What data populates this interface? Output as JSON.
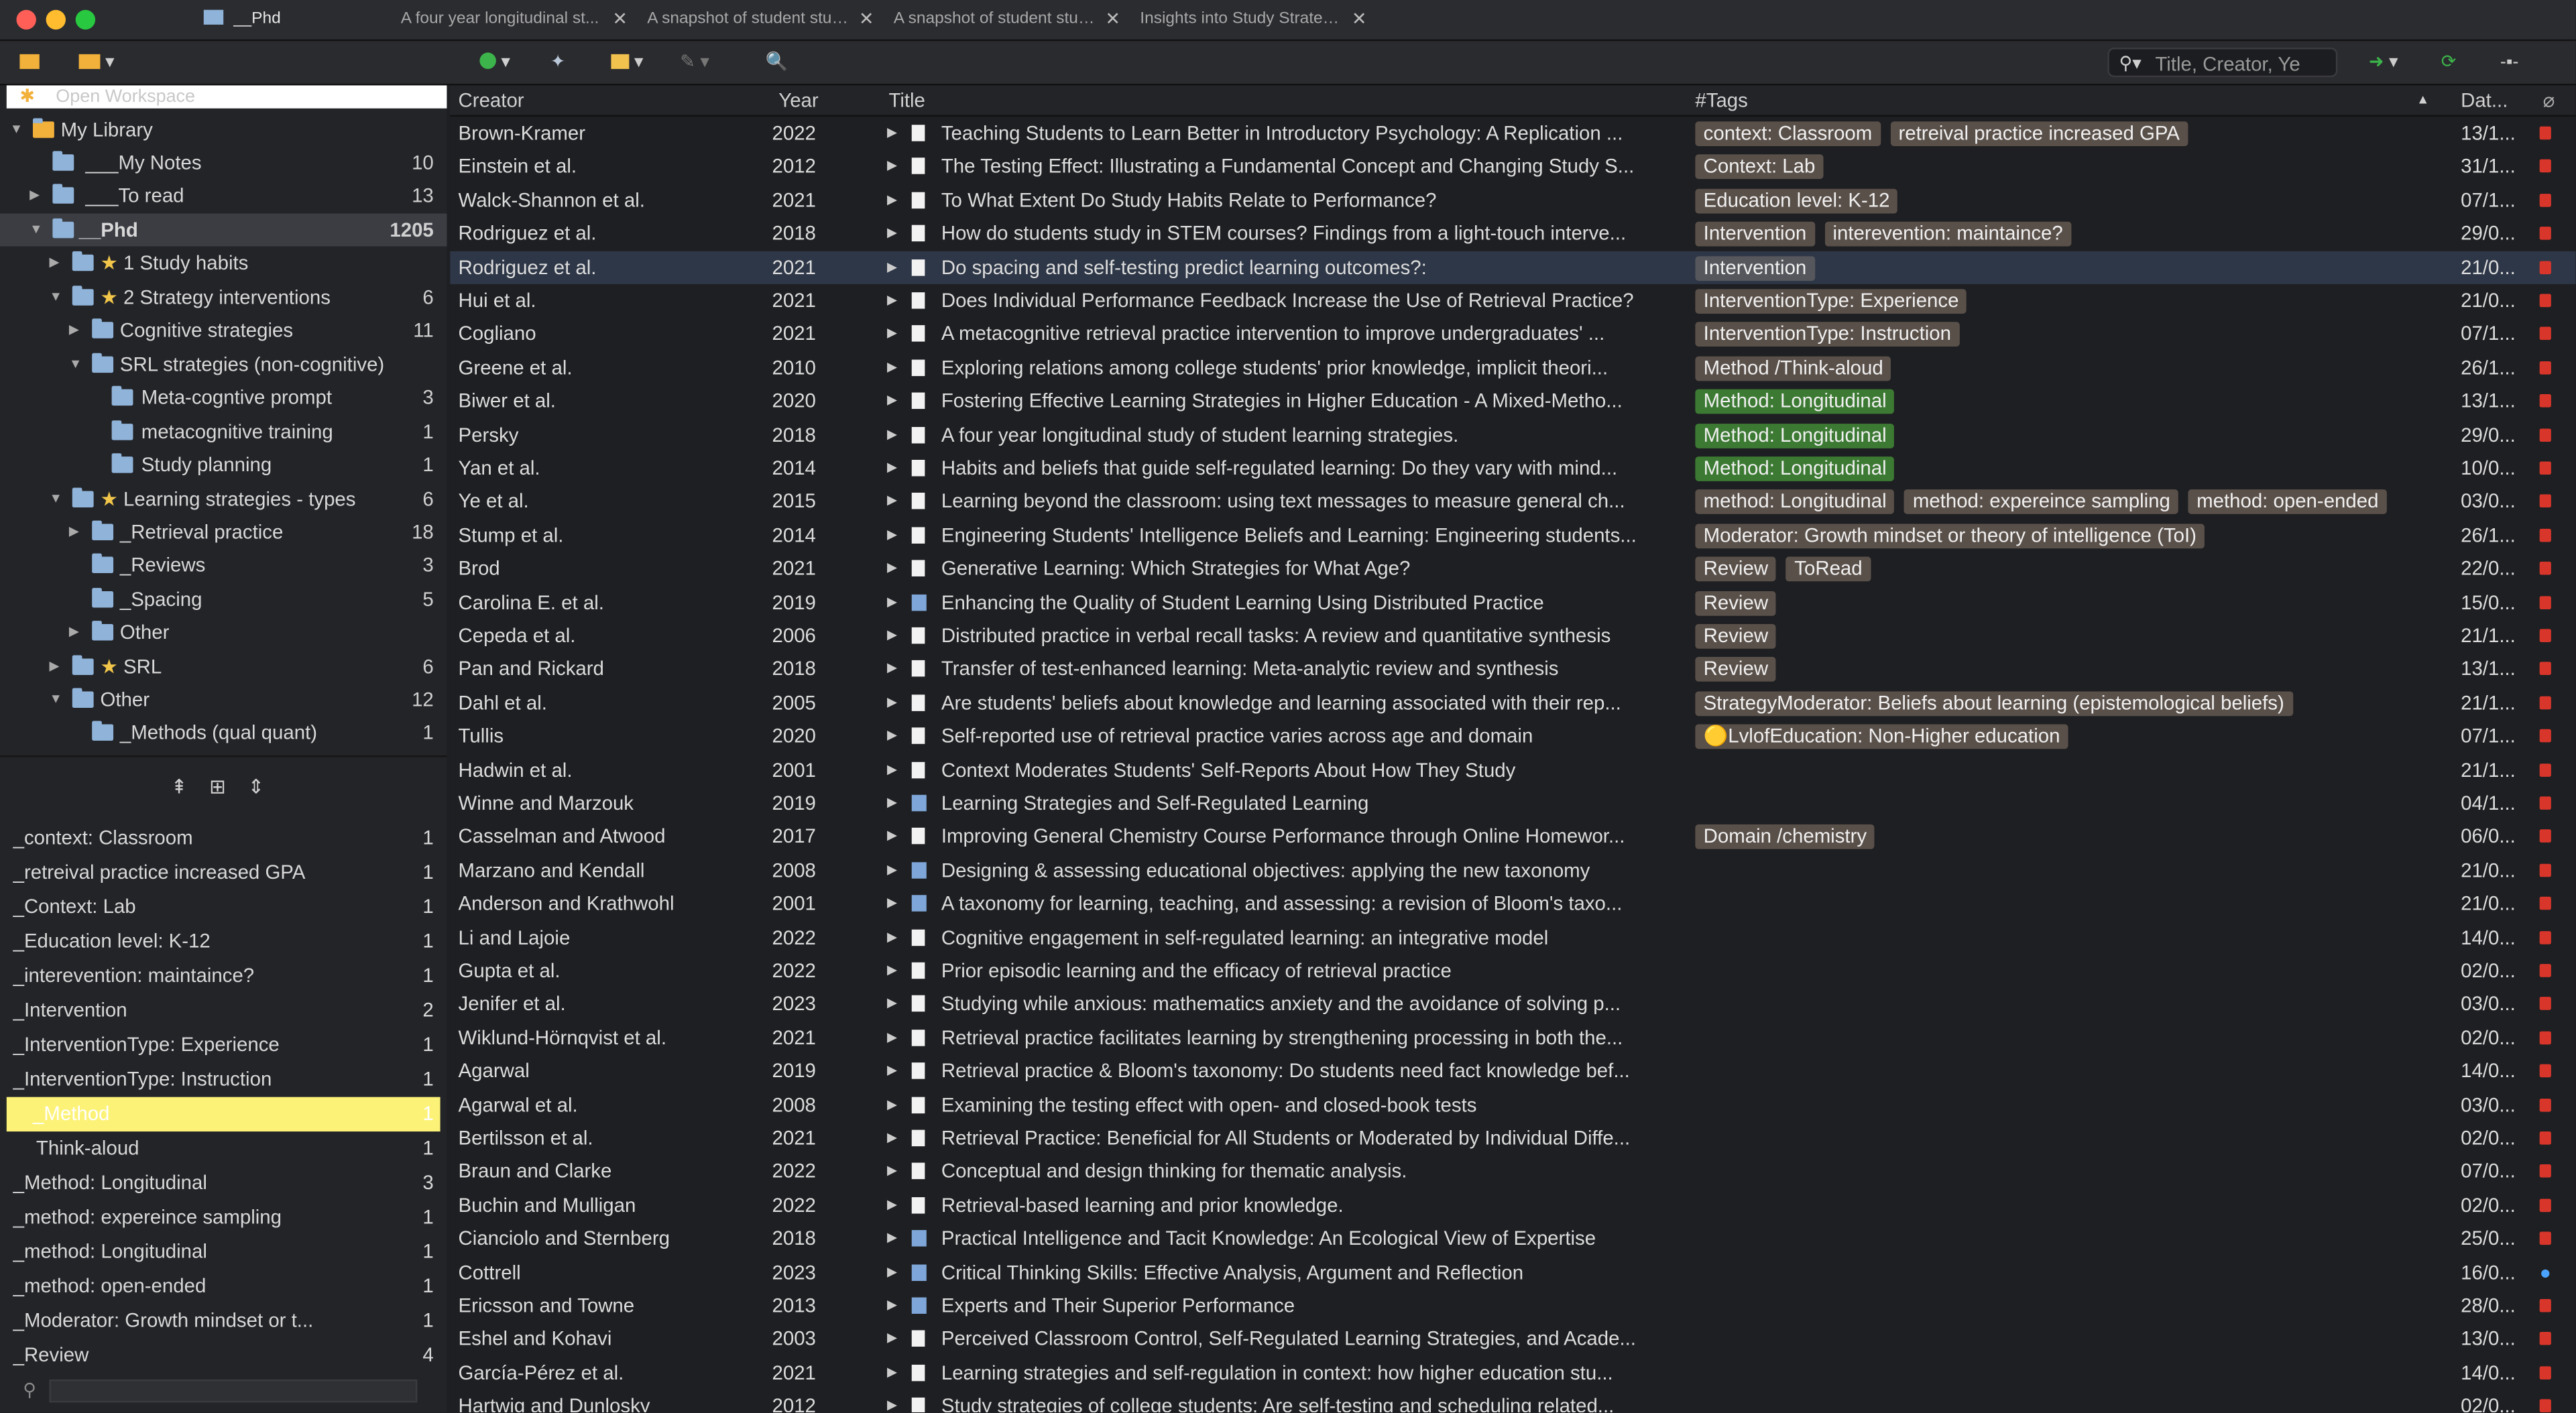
{
  "window": {
    "tabs": [
      {
        "label": "__Phd"
      },
      {
        "label": "A four year longitudinal st..."
      },
      {
        "label": "A snapshot of student stud..."
      },
      {
        "label": "A snapshot of student stud..."
      },
      {
        "label": "Insights into Study Strategi..."
      }
    ]
  },
  "toolbar": {
    "search_placeholder": "Title, Creator, Ye"
  },
  "colors": {
    "background": "#1e1f22",
    "selection_row": "#2e3747",
    "tag_default": "#5a504a",
    "tag_green": "#3c7a33",
    "highlight_yellow": "#fdf278"
  },
  "sidebar": {
    "open_workspace": "Open Workspace",
    "tree": [
      {
        "label": "My Library",
        "count": ""
      },
      {
        "label": "___My Notes",
        "count": "10"
      },
      {
        "label": "___To read",
        "count": "13"
      },
      {
        "label": "__Phd",
        "count": "1205"
      },
      {
        "label": "1 Study habits",
        "count": ""
      },
      {
        "label": "2 Strategy interventions",
        "count": "6"
      },
      {
        "label": "Cognitive strategies",
        "count": "11"
      },
      {
        "label": "SRL strategies (non-cognitive)",
        "count": ""
      },
      {
        "label": "Meta-cogntive prompt",
        "count": "3"
      },
      {
        "label": "metacognitive training",
        "count": "1"
      },
      {
        "label": "Study planning",
        "count": "1"
      },
      {
        "label": "Learning strategies - types",
        "count": "6"
      },
      {
        "label": "_Retrieval practice",
        "count": "18"
      },
      {
        "label": "_Reviews",
        "count": "3"
      },
      {
        "label": "_Spacing",
        "count": "5"
      },
      {
        "label": "Other",
        "count": ""
      },
      {
        "label": "SRL",
        "count": "6"
      },
      {
        "label": "Other",
        "count": "12"
      },
      {
        "label": "_Methods (qual quant)",
        "count": "1"
      }
    ],
    "tags": [
      {
        "label": "_context: Classroom",
        "count": "1"
      },
      {
        "label": "_retreival practice increased GPA",
        "count": "1"
      },
      {
        "label": "_Context: Lab",
        "count": "1"
      },
      {
        "label": "_Education level: K-12",
        "count": "1"
      },
      {
        "label": "_interevention: maintaince?",
        "count": "1"
      },
      {
        "label": "_Intervention",
        "count": "2"
      },
      {
        "label": "_InterventionType: Experience",
        "count": "1"
      },
      {
        "label": "_InterventionType: Instruction",
        "count": "1"
      },
      {
        "label": "_Method",
        "count": "1"
      },
      {
        "label": "Think-aloud",
        "count": "1"
      },
      {
        "label": "_Method: Longitudinal",
        "count": "3"
      },
      {
        "label": "_method: expereince sampling",
        "count": "1"
      },
      {
        "label": "_method: Longitudinal",
        "count": "1"
      },
      {
        "label": "_method: open-ended",
        "count": "1"
      },
      {
        "label": "_Moderator: Growth mindset or t...",
        "count": "1"
      },
      {
        "label": "_Review",
        "count": "4"
      }
    ]
  },
  "columns": {
    "creator": "Creator",
    "year": "Year",
    "title": "Title",
    "tags": "#Tags",
    "date": "Dat..."
  },
  "items": [
    {
      "creator": "Brown-Kramer",
      "year": "2022",
      "title": "Teaching Students to Learn Better in Introductory Psychology: A Replication ...",
      "tags": [
        "context: Classroom",
        "retreival practice increased GPA"
      ],
      "date": "13/1..."
    },
    {
      "creator": "Einstein et al.",
      "year": "2012",
      "title": "The Testing Effect: Illustrating a Fundamental Concept and Changing Study S...",
      "tags": [
        "Context: Lab"
      ],
      "date": "31/1..."
    },
    {
      "creator": "Walck-Shannon et al.",
      "year": "2021",
      "title": "To What Extent Do Study Habits Relate to Performance?",
      "tags": [
        "Education level: K-12"
      ],
      "date": "07/1..."
    },
    {
      "creator": "Rodriguez et al.",
      "year": "2018",
      "title": "How do students study in STEM courses? Findings from a light-touch interve...",
      "tags": [
        "Intervention",
        "interevention: maintaince?"
      ],
      "date": "29/0..."
    },
    {
      "creator": "Rodriguez et al.",
      "year": "2021",
      "title": "Do spacing and self-testing predict learning outcomes?:",
      "tags": [
        "Intervention"
      ],
      "date": "21/0..."
    },
    {
      "creator": "Hui et al.",
      "year": "2021",
      "title": "Does Individual Performance Feedback Increase the Use of Retrieval Practice?",
      "tags": [
        "InterventionType: Experience"
      ],
      "date": "21/0..."
    },
    {
      "creator": "Cogliano",
      "year": "2021",
      "title": "A metacognitive retrieval practice intervention to improve undergraduates' ...",
      "tags": [
        "InterventionType: Instruction"
      ],
      "date": "07/1..."
    },
    {
      "creator": "Greene et al.",
      "year": "2010",
      "title": "Exploring relations among college students' prior knowledge, implicit theori...",
      "tags": [
        "Method /Think-aloud"
      ],
      "date": "26/1..."
    },
    {
      "creator": "Biwer et al.",
      "year": "2020",
      "title": "Fostering Effective Learning Strategies in Higher Education - A Mixed-Metho...",
      "tags": [
        "Method: Longitudinal"
      ],
      "date": "13/1..."
    },
    {
      "creator": "Persky",
      "year": "2018",
      "title": "A four year longitudinal study of student learning strategies.",
      "tags": [
        "Method: Longitudinal"
      ],
      "date": "29/0..."
    },
    {
      "creator": "Yan et al.",
      "year": "2014",
      "title": "Habits and beliefs that guide self-regulated learning: Do they vary with mind...",
      "tags": [
        "Method: Longitudinal"
      ],
      "date": "10/0..."
    },
    {
      "creator": "Ye et al.",
      "year": "2015",
      "title": "Learning beyond the classroom: using text messages to measure general ch...",
      "tags": [
        "method: Longitudinal",
        "method: expereince sampling",
        "method: open-ended"
      ],
      "date": "03/0..."
    },
    {
      "creator": "Stump et al.",
      "year": "2014",
      "title": "Engineering Students' Intelligence Beliefs and Learning: Engineering students...",
      "tags": [
        "Moderator: Growth mindset or theory of intelligence (ToI)"
      ],
      "date": "26/1..."
    },
    {
      "creator": "Brod",
      "year": "2021",
      "title": "Generative Learning: Which Strategies for What Age?",
      "tags": [
        "Review",
        "ToRead"
      ],
      "date": "22/0..."
    },
    {
      "creator": "Carolina E. et al.",
      "year": "2019",
      "title": "Enhancing the Quality of Student Learning Using Distributed Practice",
      "tags": [
        "Review"
      ],
      "date": "15/0..."
    },
    {
      "creator": "Cepeda et al.",
      "year": "2006",
      "title": "Distributed practice in verbal recall tasks: A review and quantitative synthesis",
      "tags": [
        "Review"
      ],
      "date": "21/1..."
    },
    {
      "creator": "Pan and Rickard",
      "year": "2018",
      "title": "Transfer of test-enhanced learning: Meta-analytic review and synthesis",
      "tags": [
        "Review"
      ],
      "date": "13/1..."
    },
    {
      "creator": "Dahl et al.",
      "year": "2005",
      "title": "Are students' beliefs about knowledge and learning associated with their rep...",
      "tags": [
        "StrategyModerator: Beliefs about learning (epistemological beliefs)"
      ],
      "date": "21/1..."
    },
    {
      "creator": "Tullis",
      "year": "2020",
      "title": "Self-reported use of retrieval practice varies across age and domain",
      "tags": [
        "🟡LvlofEducation: Non-Higher education"
      ],
      "date": "07/1..."
    },
    {
      "creator": "Hadwin et al.",
      "year": "2001",
      "title": "Context Moderates Students' Self-Reports About How They Study",
      "tags": [],
      "date": "21/1..."
    },
    {
      "creator": "Winne and Marzouk",
      "year": "2019",
      "title": "Learning Strategies and Self-Regulated Learning",
      "tags": [],
      "date": "04/1..."
    },
    {
      "creator": "Casselman and Atwood",
      "year": "2017",
      "title": "Improving General Chemistry Course Performance through Online Homewor...",
      "tags": [
        "Domain /chemistry"
      ],
      "date": "06/0..."
    },
    {
      "creator": "Marzano and Kendall",
      "year": "2008",
      "title": "Designing & assessing educational objectives: applying the new taxonomy",
      "tags": [],
      "date": "21/0..."
    },
    {
      "creator": "Anderson and Krathwohl",
      "year": "2001",
      "title": "A taxonomy for learning, teaching, and assessing: a revision of Bloom's taxo...",
      "tags": [],
      "date": "21/0..."
    },
    {
      "creator": "Li and Lajoie",
      "year": "2022",
      "title": "Cognitive engagement in self-regulated learning: an integrative model",
      "tags": [],
      "date": "14/0..."
    },
    {
      "creator": "Gupta et al.",
      "year": "2022",
      "title": "Prior episodic learning and the efficacy of retrieval practice",
      "tags": [],
      "date": "02/0..."
    },
    {
      "creator": "Jenifer et al.",
      "year": "2023",
      "title": "Studying while anxious: mathematics anxiety and the avoidance of solving p...",
      "tags": [],
      "date": "03/0..."
    },
    {
      "creator": "Wiklund-Hörnqvist et al.",
      "year": "2021",
      "title": "Retrieval practice facilitates learning by strengthening processing in both the...",
      "tags": [],
      "date": "02/0..."
    },
    {
      "creator": "Agarwal",
      "year": "2019",
      "title": "Retrieval practice & Bloom's taxonomy: Do students need fact knowledge bef...",
      "tags": [],
      "date": "14/0..."
    },
    {
      "creator": "Agarwal et al.",
      "year": "2008",
      "title": "Examining the testing effect with open- and closed-book tests",
      "tags": [],
      "date": "03/0..."
    },
    {
      "creator": "Bertilsson et al.",
      "year": "2021",
      "title": "Retrieval Practice: Beneficial for All Students or Moderated by Individual Diffe...",
      "tags": [],
      "date": "02/0..."
    },
    {
      "creator": "Braun and Clarke",
      "year": "2022",
      "title": "Conceptual and design thinking for thematic analysis.",
      "tags": [],
      "date": "07/0..."
    },
    {
      "creator": "Buchin and Mulligan",
      "year": "2022",
      "title": "Retrieval-based learning and prior knowledge.",
      "tags": [],
      "date": "02/0..."
    },
    {
      "creator": "Cianciolo and Sternberg",
      "year": "2018",
      "title": "Practical Intelligence and Tacit Knowledge: An Ecological View of Expertise",
      "tags": [],
      "date": "25/0..."
    },
    {
      "creator": "Cottrell",
      "year": "2023",
      "title": "Critical Thinking Skills: Effective Analysis, Argument and Reflection",
      "tags": [],
      "date": "16/0..."
    },
    {
      "creator": "Ericsson and Towne",
      "year": "2013",
      "title": "Experts and Their Superior Performance",
      "tags": [],
      "date": "28/0..."
    },
    {
      "creator": "Eshel and Kohavi",
      "year": "2003",
      "title": "Perceived Classroom Control, Self-Regulated Learning Strategies, and Acade...",
      "tags": [],
      "date": "13/0..."
    },
    {
      "creator": "García-Pérez et al.",
      "year": "2021",
      "title": "Learning strategies and self-regulation in context: how higher education stu...",
      "tags": [],
      "date": "14/0..."
    },
    {
      "creator": "Hartwig and Dunlosky",
      "year": "2012",
      "title": "Study strategies of college students: Are self-testing and scheduling related...",
      "tags": [],
      "date": "02/0..."
    }
  ]
}
